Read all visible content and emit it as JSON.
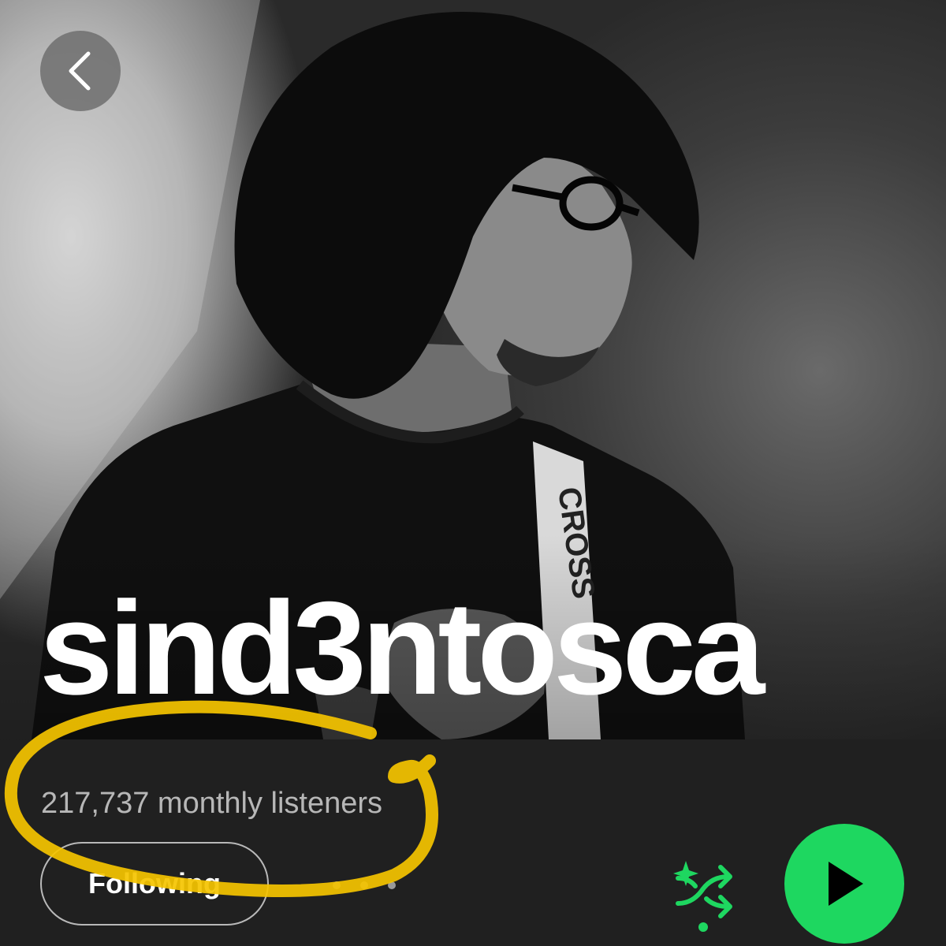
{
  "artist": {
    "name": "sind3ntosca",
    "monthly_listeners": "217,737 monthly listeners",
    "photo_strap_text": "CROSS"
  },
  "actions": {
    "follow_label": "Following",
    "more_icon": "more-horizontal-icon",
    "shuffle_icon": "shuffle-icon",
    "play_icon": "play-icon"
  },
  "nav": {
    "back_icon": "chevron-left-icon"
  },
  "colors": {
    "accent": "#1ed760",
    "background": "#202020",
    "highlight_marker": "#f5c400"
  }
}
